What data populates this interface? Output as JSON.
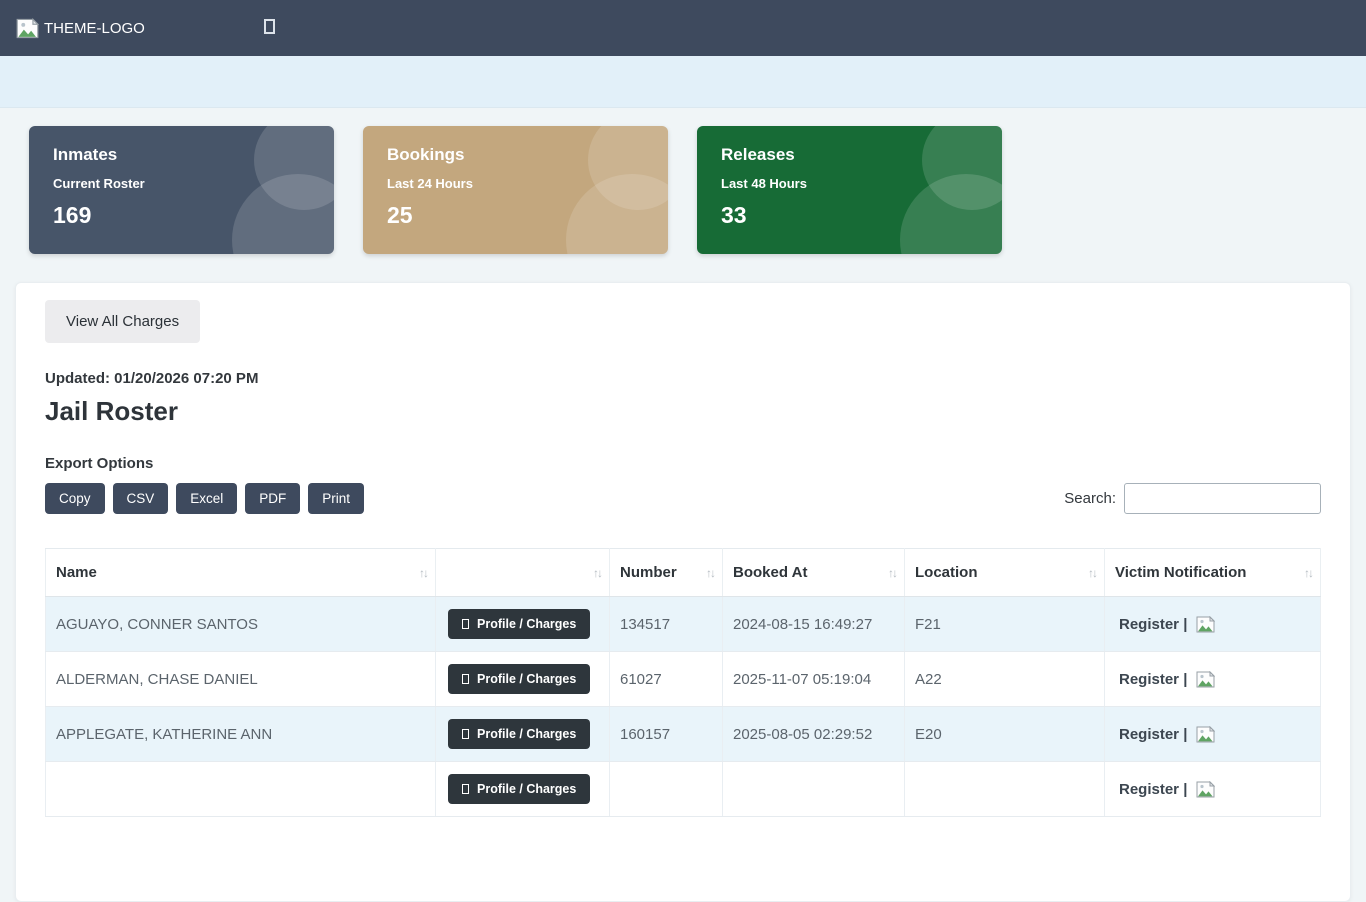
{
  "colors": {
    "navbar_bg": "#3e4a5e",
    "banner_bg": "#e2f0f9",
    "page_bg": "#f0f5f7",
    "stripe_row_bg": "#e9f4fa",
    "profile_button_bg": "#2e363c"
  },
  "navbar": {
    "logo_text": "THEME-LOGO",
    "logo_icon": "broken-image-icon",
    "toggle_icon": "missing-glyph-box"
  },
  "stat_cards": [
    {
      "title": "Inmates",
      "subtitle": "Current Roster",
      "value": "169",
      "color": "#475569"
    },
    {
      "title": "Bookings",
      "subtitle": "Last 24 Hours",
      "value": "25",
      "color": "#c3a77e"
    },
    {
      "title": "Releases",
      "subtitle": "Last 48 Hours",
      "value": "33",
      "color": "#176b36"
    }
  ],
  "toolbar": {
    "view_all_charges_label": "View All Charges",
    "updated_text": "Updated: 01/20/2026 07:20 PM",
    "page_title": "Jail Roster",
    "export_label": "Export Options",
    "export_buttons": [
      "Copy",
      "CSV",
      "Excel",
      "PDF",
      "Print"
    ],
    "search_label": "Search:",
    "search_value": ""
  },
  "table": {
    "columns": [
      "Name",
      "",
      "Number",
      "Booked At",
      "Location",
      "Victim Notification"
    ],
    "sort_glyph": "↑↓",
    "profile_button_label": "Profile / Charges",
    "profile_button_icon": "missing-glyph-box",
    "register_label": "Register |",
    "register_icon": "broken-image-icon",
    "rows": [
      {
        "name": "AGUAYO, CONNER SANTOS",
        "number": "134517",
        "booked_at": "2024-08-15 16:49:27",
        "location": "F21"
      },
      {
        "name": "ALDERMAN, CHASE DANIEL",
        "number": "61027",
        "booked_at": "2025-11-07 05:19:04",
        "location": "A22"
      },
      {
        "name": "APPLEGATE, KATHERINE ANN",
        "number": "160157",
        "booked_at": "2025-08-05 02:29:52",
        "location": "E20"
      },
      {
        "name": "",
        "number": "",
        "booked_at": "",
        "location": "",
        "partially_visible": true
      }
    ]
  }
}
